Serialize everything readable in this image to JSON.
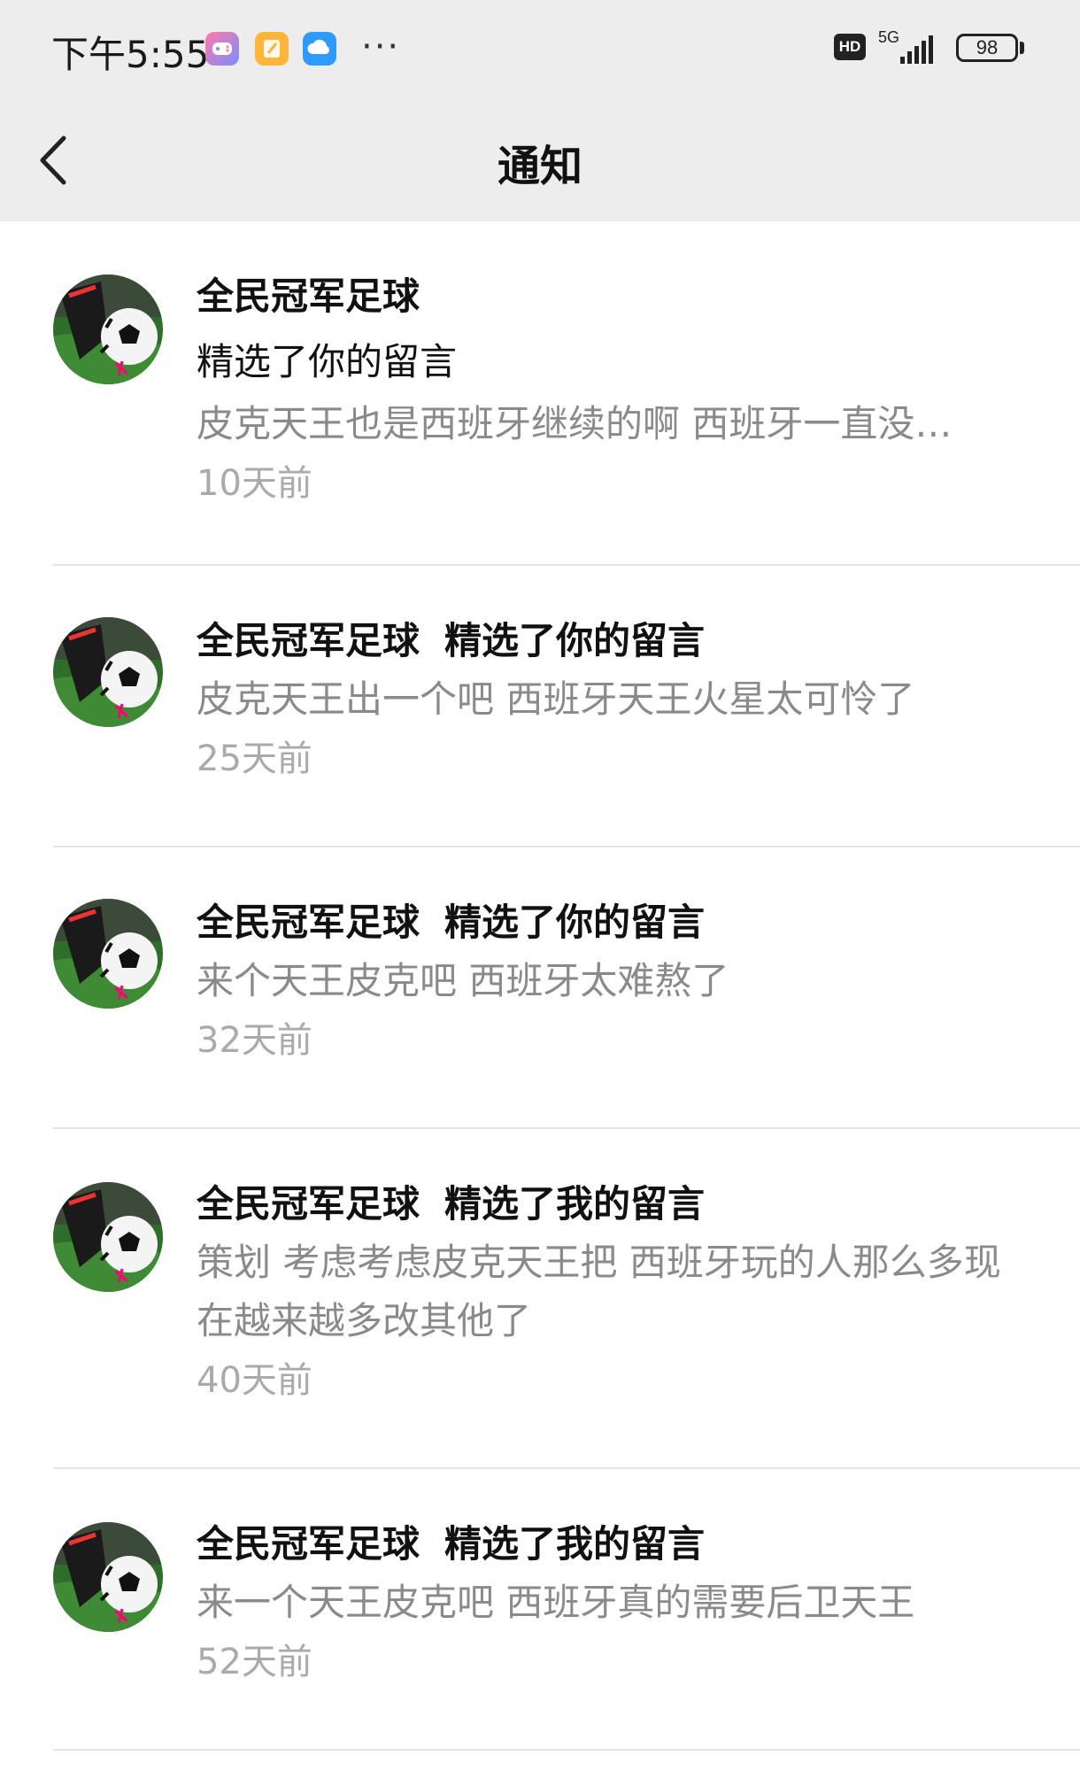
{
  "status_bar": {
    "time": "下午5:55",
    "network": "5G",
    "hd": "HD",
    "battery": "98"
  },
  "header": {
    "title": "通知"
  },
  "notifications": [
    {
      "sender": "全民冠军足球",
      "action": "精选了你的留言",
      "comment": "皮克天王也是西班牙继续的啊 西班牙一直没…",
      "time": "10天前"
    },
    {
      "sender": "全民冠军足球",
      "action": "精选了你的留言",
      "comment": "皮克天王出一个吧 西班牙天王火星太可怜了",
      "time": "25天前"
    },
    {
      "sender": "全民冠军足球",
      "action": "精选了你的留言",
      "comment": "来个天王皮克吧 西班牙太难熬了",
      "time": "32天前"
    },
    {
      "sender": "全民冠军足球",
      "action": "精选了我的留言",
      "comment": "策划 考虑考虑皮克天王把 西班牙玩的人那么多现在越来越多改其他了",
      "time": "40天前"
    },
    {
      "sender": "全民冠军足球",
      "action": "精选了我的留言",
      "comment": "来一个天王皮克吧 西班牙真的需要后卫天王",
      "time": "52天前"
    }
  ]
}
